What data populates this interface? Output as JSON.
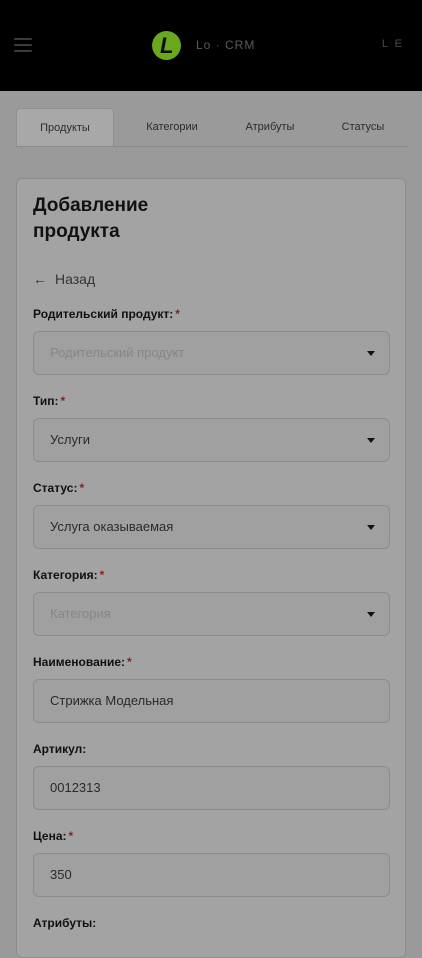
{
  "header": {
    "brand": "Lo · CRM",
    "right_text": "L E"
  },
  "tabs": [
    {
      "label": "Продукты"
    },
    {
      "label": "Категории"
    },
    {
      "label": "Атрибуты"
    },
    {
      "label": "Статусы"
    }
  ],
  "form": {
    "title": "Добавление продукта",
    "back_label": "Назад",
    "required_mark": "*",
    "fields": {
      "parent": {
        "label": "Родительский продукт:",
        "placeholder": "Родительский продукт"
      },
      "type": {
        "label": "Тип:",
        "value": "Услуги"
      },
      "status": {
        "label": "Статус:",
        "value": "Услуга оказываемая"
      },
      "category": {
        "label": "Категория:",
        "placeholder": "Категория"
      },
      "name": {
        "label": "Наименование:",
        "value": "Стрижка Модельная"
      },
      "sku": {
        "label": "Артикул:",
        "value": "0012313"
      },
      "price": {
        "label": "Цена:",
        "value": "350"
      },
      "attributes": {
        "label": "Атрибуты:"
      }
    }
  },
  "colors": {
    "topbar": "#000000",
    "logo": "#6aa81e",
    "required": "#8a2020"
  }
}
